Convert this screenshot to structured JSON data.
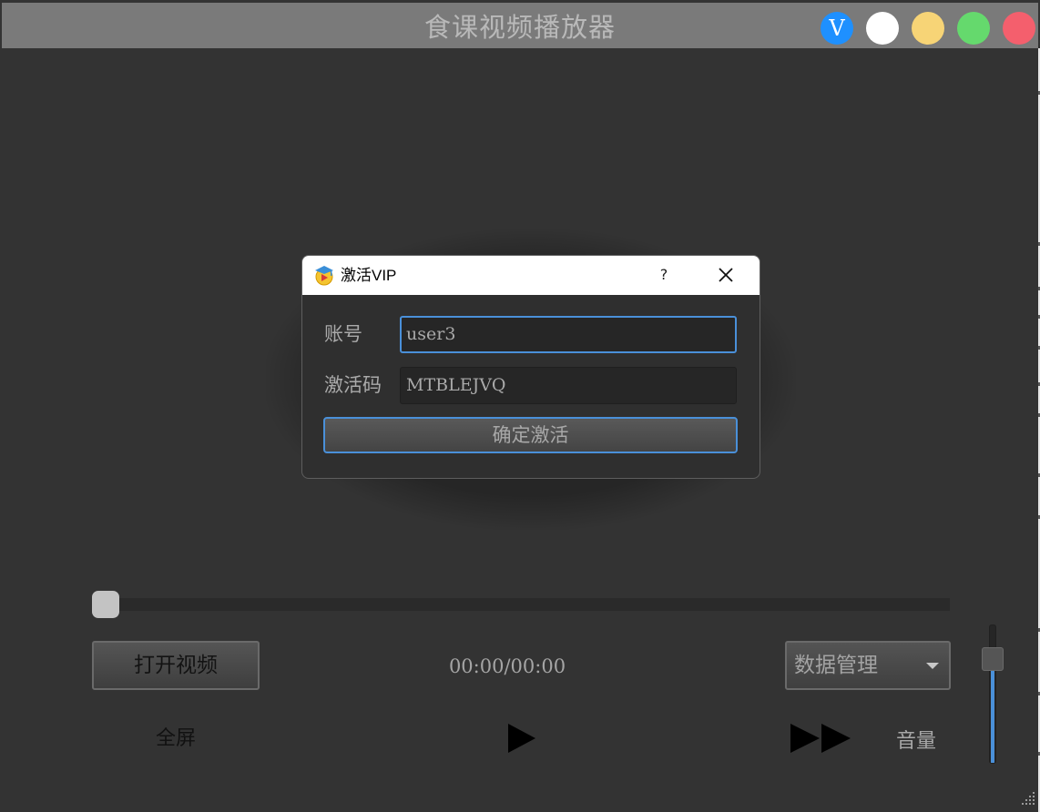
{
  "window": {
    "title": "食课视频播放器",
    "controls": [
      {
        "name": "vip-button",
        "label": "V",
        "color": "#1e90ff"
      },
      {
        "name": "skin-white-button",
        "color": "#ffffff"
      },
      {
        "name": "minimize-button",
        "color": "#f7d476"
      },
      {
        "name": "maximize-button",
        "color": "#65d96d"
      },
      {
        "name": "close-button",
        "color": "#f45f6d"
      }
    ]
  },
  "dialog": {
    "title": "激活VIP",
    "icon": "vip-badge-icon",
    "help_label": "?",
    "fields": {
      "account": {
        "label": "账号",
        "value": "user3"
      },
      "code": {
        "label": "激活码",
        "value": "MTBLEJVQ"
      }
    },
    "confirm_label": "确定激活"
  },
  "player": {
    "progress": 0,
    "open_video_label": "打开视频",
    "time_display": "00:00/00:00",
    "data_select": {
      "selected": "数据管理"
    },
    "fullscreen_label": "全屏",
    "play_icon": "play-icon",
    "forward_icon": "fast-forward-icon",
    "volume_label": "音量",
    "volume_level": 0.84
  },
  "colors": {
    "background": "#333333",
    "titlebar": "#7a7a7a",
    "accent": "#4a90d9"
  }
}
